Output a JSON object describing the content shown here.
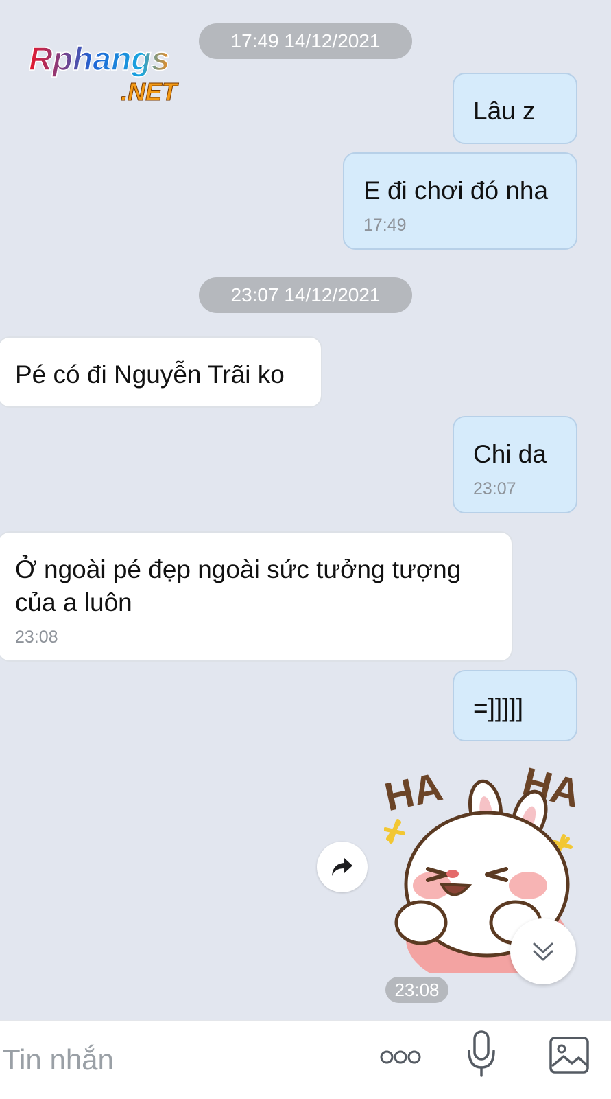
{
  "watermark": {
    "text": "Rphangs .NET"
  },
  "timestamps": {
    "first": "17:49 14/12/2021",
    "second": "23:07 14/12/2021"
  },
  "messages": [
    {
      "direction": "out",
      "text": "Lâu z",
      "time": ""
    },
    {
      "direction": "out",
      "text": "E đi chơi đó nha",
      "time": "17:49"
    },
    {
      "direction": "in",
      "text": "Pé có đi Nguyễn Trãi ko",
      "time": ""
    },
    {
      "direction": "out",
      "text": "Chi da",
      "time": "23:07"
    },
    {
      "direction": "in",
      "text": "Ở ngoài pé đẹp ngoài sức tưởng tượng của a luôn",
      "time": "23:08"
    },
    {
      "direction": "out",
      "text": "=]]]]]",
      "time": ""
    }
  ],
  "sticker": {
    "caption_left": "HA",
    "caption_right": "HA",
    "time": "23:08"
  },
  "composer": {
    "placeholder": "Tin nhắn"
  },
  "icons": {
    "more": "more-dots-icon",
    "mic": "microphone-icon",
    "image": "image-icon",
    "forward": "forward-icon",
    "scroll": "chevron-double-down-icon"
  },
  "colors": {
    "background": "#e2e6ef",
    "outgoing_bubble": "#d6ebfb",
    "incoming_bubble": "#ffffff",
    "timestamp_pill": "#b5b8bd"
  }
}
